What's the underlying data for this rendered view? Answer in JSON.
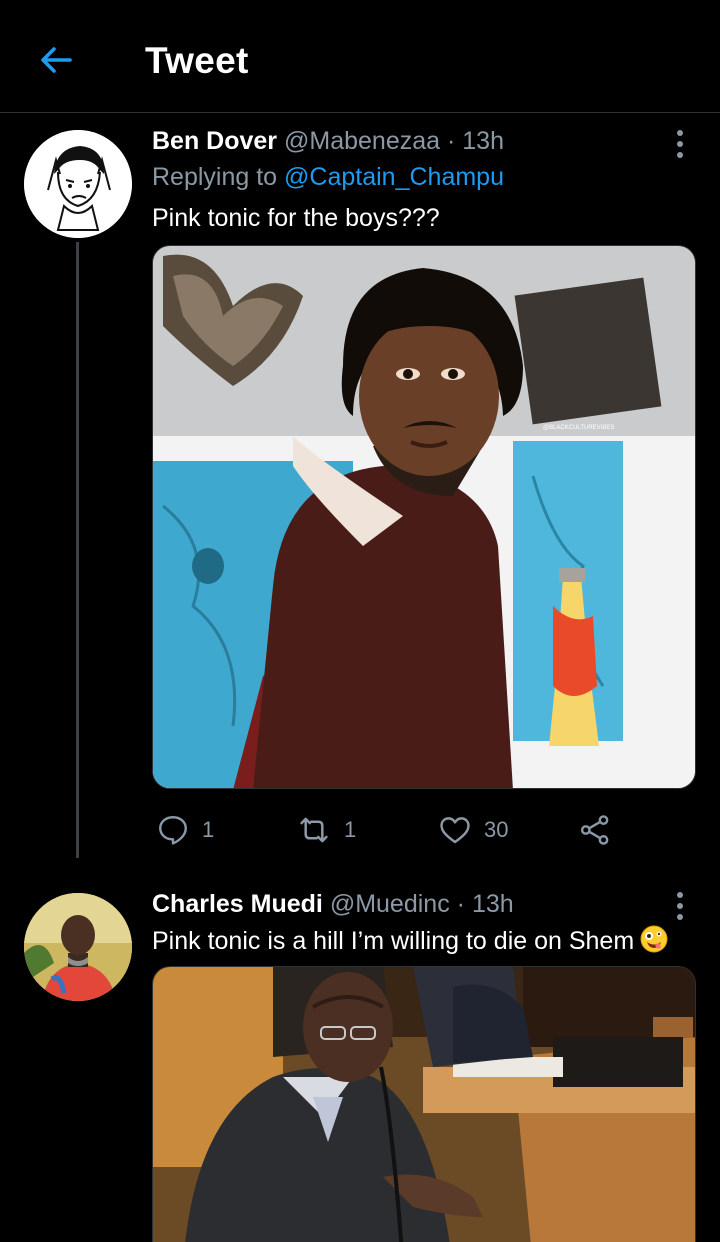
{
  "header": {
    "title": "Tweet"
  },
  "tweets": [
    {
      "name": "Ben Dover",
      "handle": "@Mabenezaa",
      "dot": "·",
      "time": "13h",
      "replying_prefix": "Replying to",
      "replying_to": "@Captain_Champu",
      "text": "Pink tonic for the boys???",
      "watermark": "@BLACKCULTUREVIBES",
      "actions": {
        "replies": "1",
        "retweets": "1",
        "likes": "30"
      }
    },
    {
      "name": "Charles Muedi",
      "handle": "@Muedinc",
      "dot": "·",
      "time": "13h",
      "text": "Pink tonic is a hill I’m willing to die on Shem",
      "emoji": "zany-face"
    }
  ],
  "colors": {
    "background": "#000000",
    "accent": "#1d9bf0",
    "secondary_text": "#8b98a5",
    "divider": "#2f3336"
  }
}
